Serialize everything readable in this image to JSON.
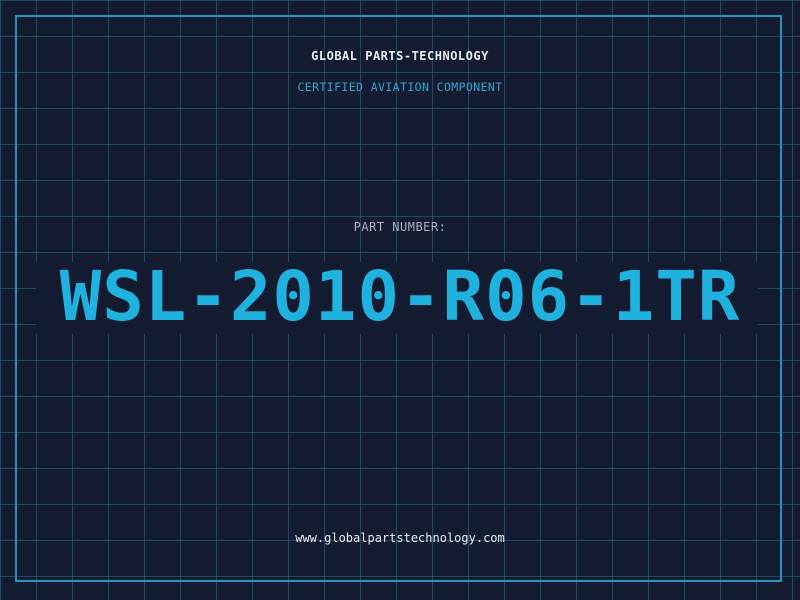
{
  "header": {
    "company": "GLOBAL PARTS-TECHNOLOGY",
    "subtitle": "CERTIFIED AVIATION COMPONENT"
  },
  "main": {
    "label": "PART NUMBER:",
    "part_number": "WSL-2010-R06-1TR"
  },
  "footer": {
    "url": "www.globalpartstechnology.com"
  },
  "colors": {
    "background": "#131b30",
    "grid": "#286e8c",
    "accent": "#1fb2de",
    "frame": "#1f97c0",
    "text": "#e8edf5",
    "label": "#a9b1bf"
  }
}
